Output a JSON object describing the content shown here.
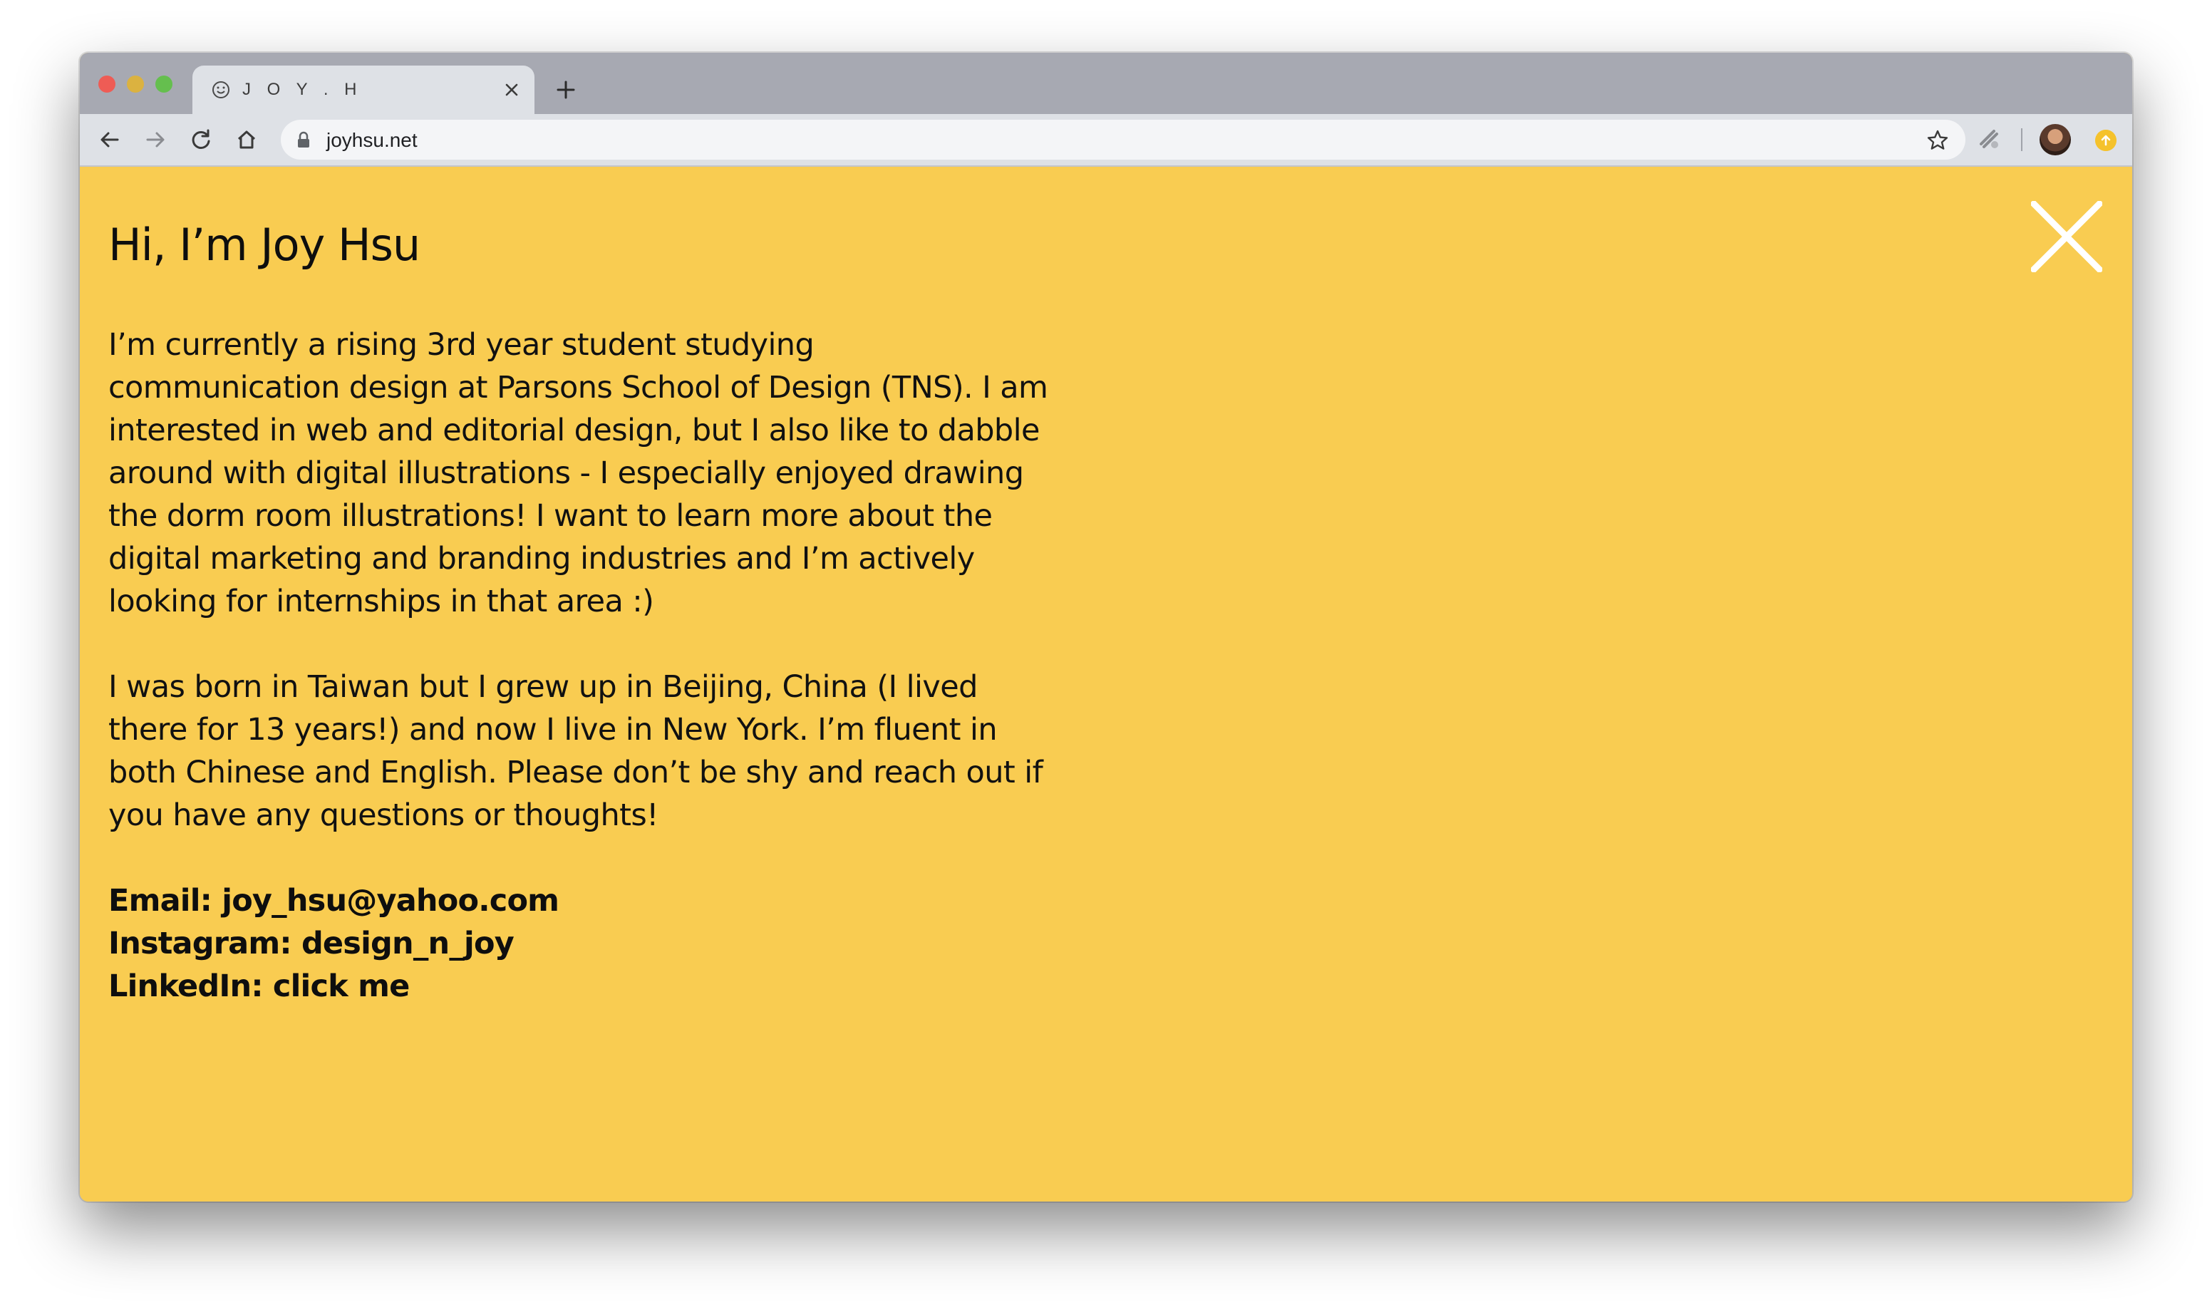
{
  "browser": {
    "tab": {
      "title": "J O Y . H",
      "favicon": "smiley-face-icon"
    },
    "url": "joyhsu.net",
    "colors": {
      "tabstrip": "#a7a9b2",
      "toolbar": "#dee1e6"
    }
  },
  "page": {
    "background": "#f9cc51",
    "title": "Hi, I’m Joy Hsu",
    "paragraph_1": "I’m currently a rising 3rd year student studying communication design at Parsons School of Design (TNS). I am interested in web and editorial design, but I also like to dabble around with digital illustrations - I especially enjoyed drawing the dorm room illustrations! I want to learn more about the digital marketing and branding industries and I’m actively looking for internships in that area :)",
    "paragraph_2": "I was born in Taiwan but I grew up in Beijing, China (I lived there for 13 years!) and now I live in New York. I’m fluent in both Chinese and English. Please don’t be shy and reach out if you have any questions or thoughts!",
    "contacts": {
      "email_label": "Email: ",
      "email_value": "joy_hsu@yahoo.com",
      "instagram_label": "Instagram: ",
      "instagram_value": "design_n_joy",
      "linkedin_label": "LinkedIn: ",
      "linkedin_value": "click me"
    },
    "close_icon": "close-x-icon"
  }
}
